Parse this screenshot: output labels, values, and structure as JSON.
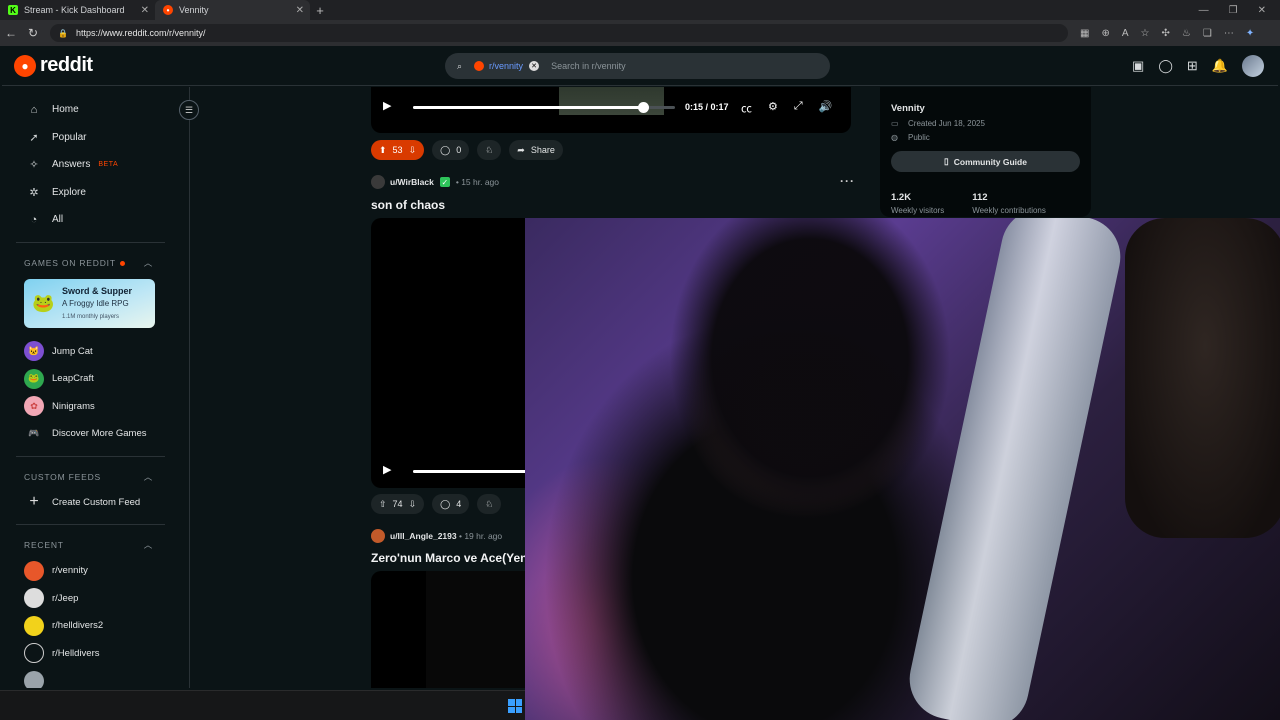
{
  "browser": {
    "tabs": [
      {
        "label": "Stream - Kick Dashboard",
        "active": false,
        "favicon_color": "#53fc18"
      },
      {
        "label": "Vennity",
        "active": true,
        "favicon_color": "#ff4500"
      }
    ],
    "url": "https://www.reddit.com/r/vennity/"
  },
  "header": {
    "logo_text": "reddit",
    "search_chip": "r/vennity",
    "search_placeholder": "Search in r/vennity"
  },
  "sidebar": {
    "nav": [
      {
        "label": "Home",
        "icon": "home-icon",
        "glyph": "⌂"
      },
      {
        "label": "Popular",
        "icon": "popular-icon",
        "glyph": "➚"
      },
      {
        "label": "Answers",
        "icon": "answers-icon",
        "glyph": "✧",
        "badge": "BETA"
      },
      {
        "label": "Explore",
        "icon": "explore-icon",
        "glyph": "✲"
      },
      {
        "label": "All",
        "icon": "all-icon",
        "glyph": "◔"
      }
    ],
    "games_heading": "GAMES ON REDDIT",
    "featured_game": {
      "title": "Sword & Supper",
      "subtitle": "A Froggy Idle RPG",
      "players": "1.1M monthly players"
    },
    "games": [
      {
        "label": "Jump Cat",
        "color": "#7d4fd1",
        "glyph": "🐱"
      },
      {
        "label": "LeapCraft",
        "color": "#2fa84f",
        "glyph": "🐸"
      },
      {
        "label": "Ninigrams",
        "color": "#f2a7b5",
        "glyph": "✿"
      },
      {
        "label": "Discover More Games",
        "color": "transparent",
        "glyph": "🎮"
      }
    ],
    "custom_feeds_heading": "CUSTOM FEEDS",
    "create_custom_feed": "Create Custom Feed",
    "recent_heading": "RECENT",
    "recent": [
      {
        "label": "r/vennity",
        "color": "#e8572a"
      },
      {
        "label": "r/Jeep",
        "color": "#dddddd"
      },
      {
        "label": "r/helldivers2",
        "color": "#f2d21b"
      },
      {
        "label": "r/Helldivers",
        "color": "#0b1416"
      }
    ]
  },
  "posts": [
    {
      "video_time": "0:15 / 0:17",
      "progress": 0.88,
      "votes": "53",
      "comments": "0",
      "share_label": "Share"
    },
    {
      "user": "u/WirBlack",
      "age": "15 hr. ago",
      "title": "son of chaos",
      "progress": 0.7,
      "votes": "74",
      "comments": "4"
    },
    {
      "user": "u/Ill_Angle_2193",
      "age": "19 hr. ago",
      "title": "Zero'nun Marco ve Ace(Yen"
    }
  ],
  "community": {
    "name": "Vennity",
    "created": "Created Jun 18, 2025",
    "visibility": "Public",
    "guide_label": "Community Guide",
    "stats": [
      {
        "value": "1.2K",
        "label": "Weekly visitors"
      },
      {
        "value": "112",
        "label": "Weekly contributions"
      }
    ]
  },
  "webcam": {
    "description_icon": "webcam-overlay"
  }
}
